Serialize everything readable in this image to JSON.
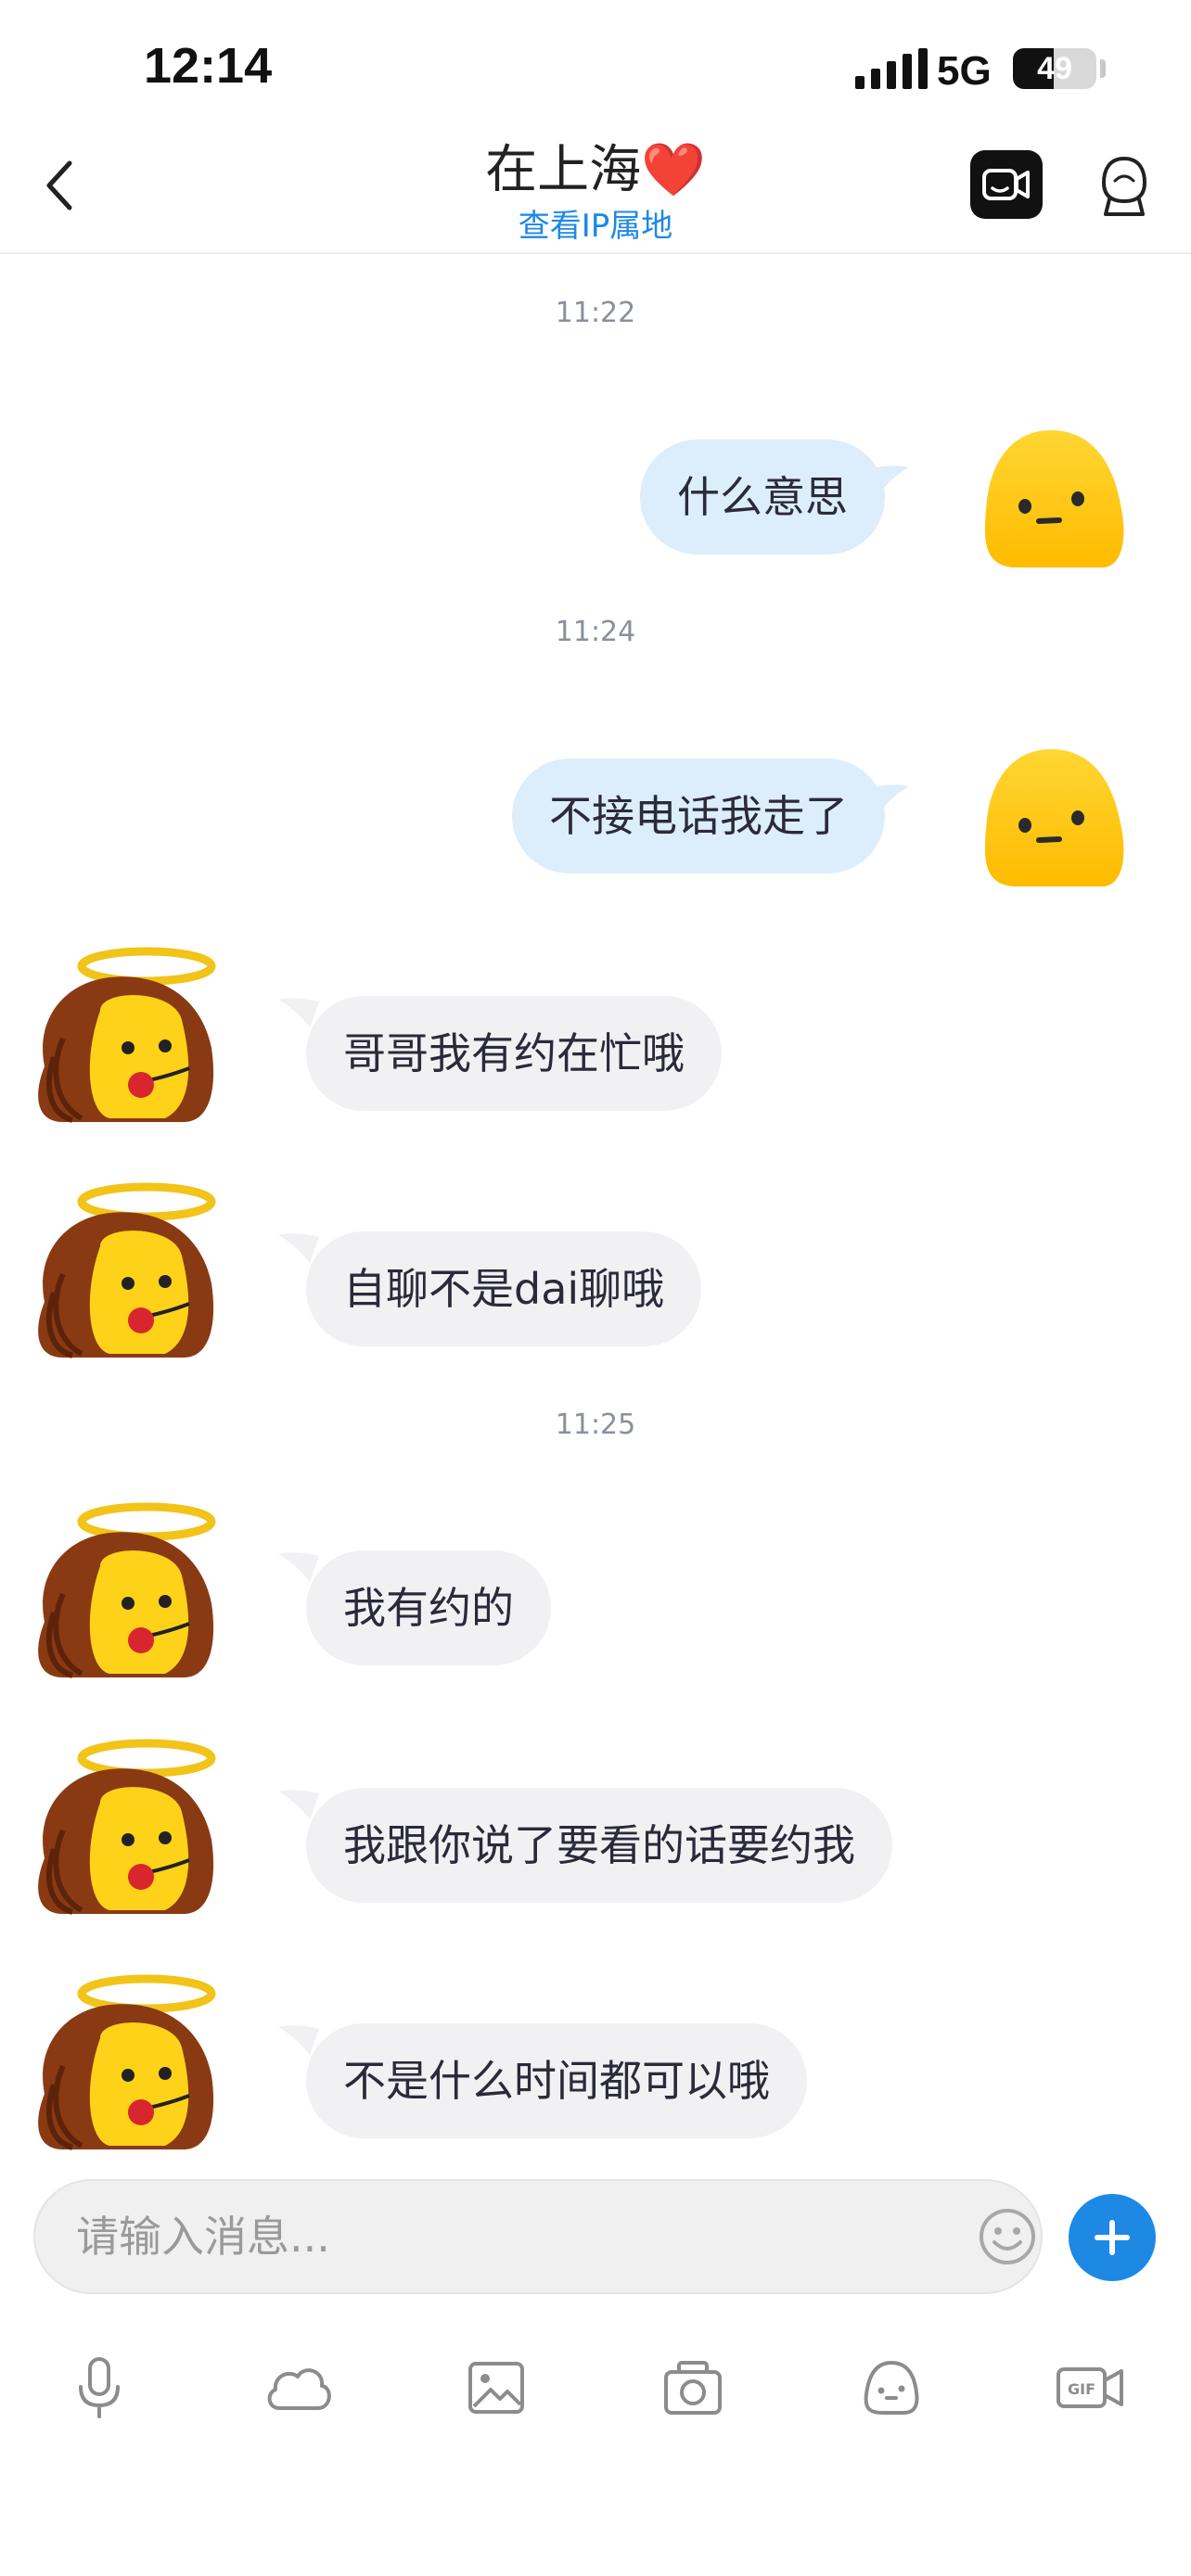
{
  "status": {
    "time": "12:14",
    "network": "5G",
    "battery": "49",
    "battery_level": 0.49
  },
  "header": {
    "title": "在上海",
    "heart": "❤️",
    "subtitle": "查看IP属地"
  },
  "messages": [
    {
      "type": "time",
      "text": "11:22"
    },
    {
      "type": "out",
      "text": "什么意思"
    },
    {
      "type": "time",
      "text": "11:24"
    },
    {
      "type": "out",
      "text": "不接电话我走了"
    },
    {
      "type": "in",
      "text": "哥哥我有约在忙哦"
    },
    {
      "type": "in",
      "text": "自聊不是dai聊哦"
    },
    {
      "type": "time",
      "text": "11:25"
    },
    {
      "type": "in",
      "text": "我有约的"
    },
    {
      "type": "in",
      "text": "我跟你说了要看的话要约我"
    },
    {
      "type": "in",
      "text": "不是什么时间都可以哦"
    }
  ],
  "input": {
    "placeholder": "请输入消息..."
  },
  "toolbar": [
    "microphone-icon",
    "cloud-icon",
    "image-icon",
    "camera-icon",
    "sticker-icon",
    "gif-icon"
  ],
  "colors": {
    "accent": "#1e88e5",
    "outgoing_bubble": "#dcedfb",
    "incoming_bubble": "#f1f1f3"
  }
}
